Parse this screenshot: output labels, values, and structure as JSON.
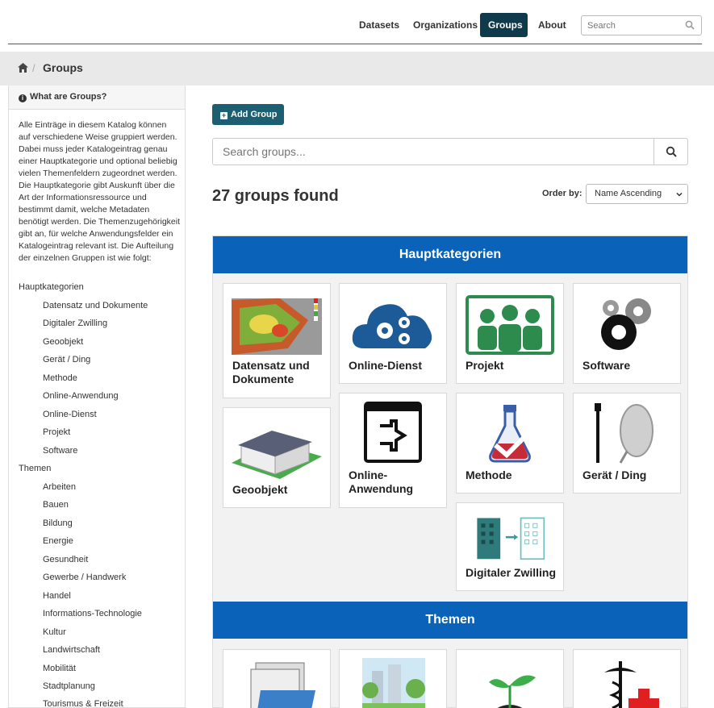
{
  "nav": {
    "datasets": "Datasets",
    "organizations": "Organizations",
    "groups": "Groups",
    "about": "About",
    "search_placeholder": "Search"
  },
  "breadcrumb": {
    "current": "Groups"
  },
  "sidebar": {
    "title": "What are Groups?",
    "description": "Alle Einträge in diesem Katalog können auf verschiedene Weise gruppiert werden. Dabei muss jeder Katalogeintrag genau einer Hauptkategorie und optional beliebig vielen Themenfeldern zugeordnet werden. Die Hauptkategorie gibt Auskunft über die Art der Informationsressource und bestimmt damit, welche Metadaten benötigt werden. Die Themenzugehörigkeit gibt an, für welche Anwendungsfelder ein Katalogeintrag relevant ist. Die Aufteilung der einzelnen Gruppen ist wie folgt:",
    "cat1": "Hauptkategorien",
    "cat1_items": [
      "Datensatz und Dokumente",
      "Digitaler Zwilling",
      "Geoobjekt",
      "Gerät / Ding",
      "Methode",
      "Online-Anwendung",
      "Online-Dienst",
      "Projekt",
      "Software"
    ],
    "cat2": "Themen",
    "cat2_items": [
      "Arbeiten",
      "Bauen",
      "Bildung",
      "Energie",
      "Gesundheit",
      "Gewerbe / Handwerk",
      "Handel",
      "Informations-Technologie",
      "Kultur",
      "Landwirtschaft",
      "Mobilität",
      "Stadtplanung",
      "Tourismus & Freizeit"
    ]
  },
  "main": {
    "add_group": "Add Group",
    "search_placeholder": "Search groups...",
    "found": "27 groups found",
    "order_label": "Order by:",
    "order_value": "Name Ascending",
    "section1": "Hauptkategorien",
    "cards1": [
      "Datensatz und Dokumente",
      "Online-Dienst",
      "Projekt",
      "Software",
      "Geoobjekt",
      "Online-Anwendung",
      "Methode",
      "Gerät / Ding",
      "Digitaler Zwilling"
    ],
    "section2": "Themen"
  },
  "colors": {
    "nav_active": "#0f3a4b",
    "button": "#1c5f73",
    "section_header": "#0a63b8"
  }
}
